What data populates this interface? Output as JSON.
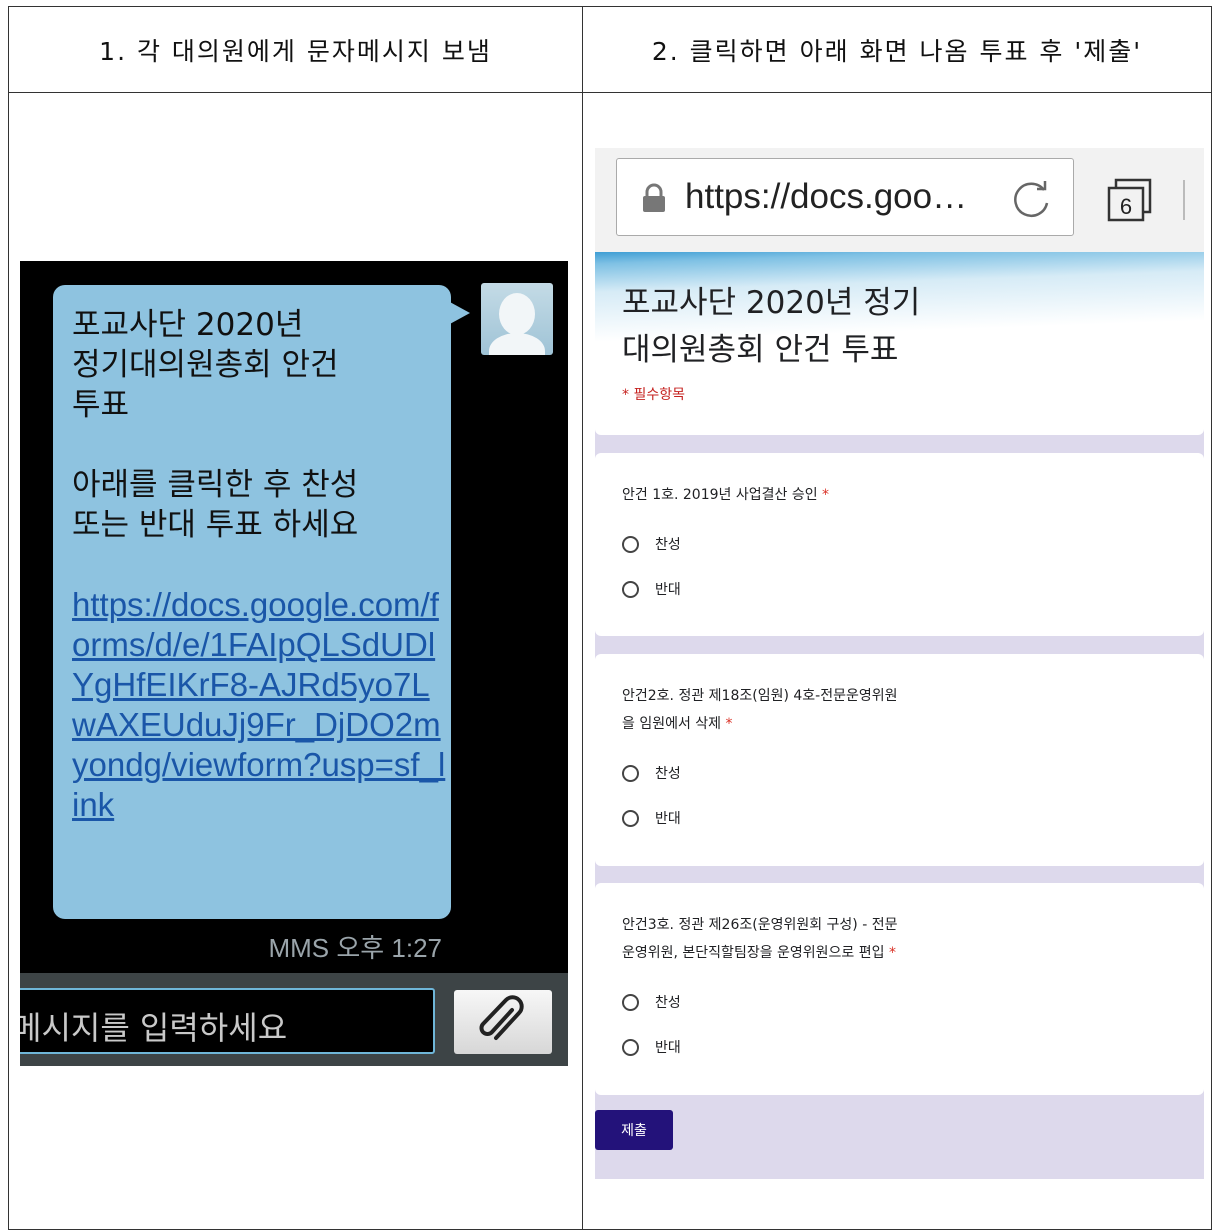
{
  "header": {
    "step1": "1. 각 대의원에게 문자메시지 보냄",
    "step2": "2. 클릭하면 아래 화면 나옴 투표 후 '제출'"
  },
  "sms": {
    "message": "포교사단 2020년\n정기대의원총회 안건\n투표\n\n아래를 클릭한 후 찬성\n또는 반대 투표 하세요",
    "link": "https://docs.google.com/forms/d/e/1FAIpQLSdUDlYgHfEIKrF8-AJRd5yo7LwAXEUduJj9Fr_DjDO2myondg/viewform?usp=sf_link",
    "timestamp": "MMS 오후 1:27",
    "input_placeholder": "메시지를 입력하세요",
    "attach_icon": "paperclip-icon"
  },
  "browser": {
    "url": "https://docs.goo…",
    "tab_count": "6"
  },
  "form": {
    "title": "포교사단 2020년 정기\n대의원총회 안건 투표",
    "required_note": "* 필수항목",
    "questions": [
      {
        "title": "안건 1호. 2019년 사업결산 승인",
        "options": [
          "찬성",
          "반대"
        ]
      },
      {
        "title": "안건2호. 정관 제18조(임원) 4호-전문운영위원\n을 임원에서 삭제",
        "options": [
          "찬성",
          "반대"
        ]
      },
      {
        "title": "안건3호. 정관 제26조(운영위원회 구성) - 전문\n운영위원, 본단직할팀장을 운영위원으로 편입",
        "options": [
          "찬성",
          "반대"
        ]
      }
    ],
    "required_mark": "*",
    "submit_label": "제출"
  }
}
